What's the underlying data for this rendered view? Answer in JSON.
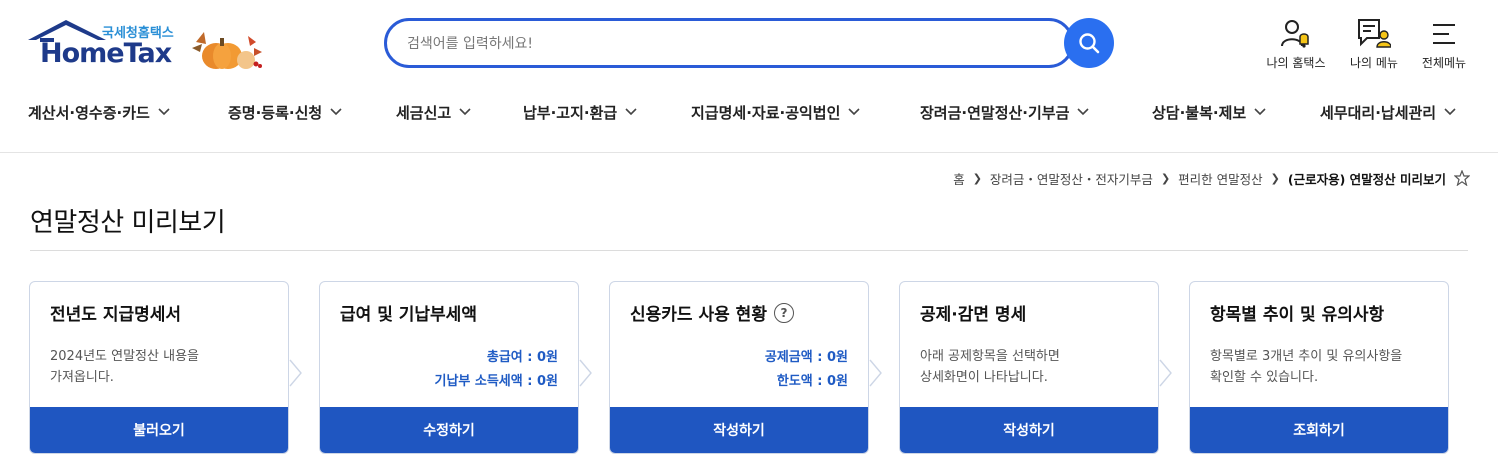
{
  "logo": {
    "sub": "국세청홈택스",
    "main": "HomeTax"
  },
  "search": {
    "placeholder": "검색어를 입력하세요!"
  },
  "utilities": [
    {
      "label": "나의 홈택스",
      "icon": "user-bell-icon"
    },
    {
      "label": "나의 메뉴",
      "icon": "my-menu-icon"
    },
    {
      "label": "전체메뉴",
      "icon": "hamburger-menu-icon"
    }
  ],
  "nav": [
    {
      "label": "계산서·영수증·카드"
    },
    {
      "label": "증명·등록·신청"
    },
    {
      "label": "세금신고"
    },
    {
      "label": "납부·고지·환급"
    },
    {
      "label": "지급명세·자료·공익법인"
    },
    {
      "label": "장려금·연말정산·기부금"
    },
    {
      "label": "상담·불복·제보"
    },
    {
      "label": "세무대리·납세관리"
    }
  ],
  "breadcrumb": {
    "items": [
      "홈",
      "장려금・연말정산・전자기부금",
      "편리한 연말정산"
    ],
    "current": "(근로자용) 연말정산 미리보기"
  },
  "page": {
    "title": "연말정산 미리보기"
  },
  "cards": [
    {
      "title": "전년도 지급명세서",
      "desc1": "2024년도 연말정산 내용을",
      "desc2": "가져옵니다.",
      "button": "불러오기"
    },
    {
      "title": "급여 및 기납부세액",
      "val1": "총급여 : 0원",
      "val2": "기납부 소득세액 : 0원",
      "button": "수정하기"
    },
    {
      "title": "신용카드 사용 현황",
      "help": "?",
      "val1": "공제금액 : 0원",
      "val2": "한도액 : 0원",
      "button": "작성하기"
    },
    {
      "title": "공제·감면 명세",
      "desc1": "아래 공제항목을 선택하면",
      "desc2": "상세화면이 나타납니다.",
      "button": "작성하기"
    },
    {
      "title": "항목별 추이 및 유의사항",
      "desc1": "항목별로 3개년 추이 및 유의사항을",
      "desc2": "확인할 수 있습니다.",
      "button": "조회하기"
    }
  ],
  "colors": {
    "primary": "#1f56c1",
    "search_border": "#2a5bd7",
    "value_text": "#1f5bc4"
  }
}
